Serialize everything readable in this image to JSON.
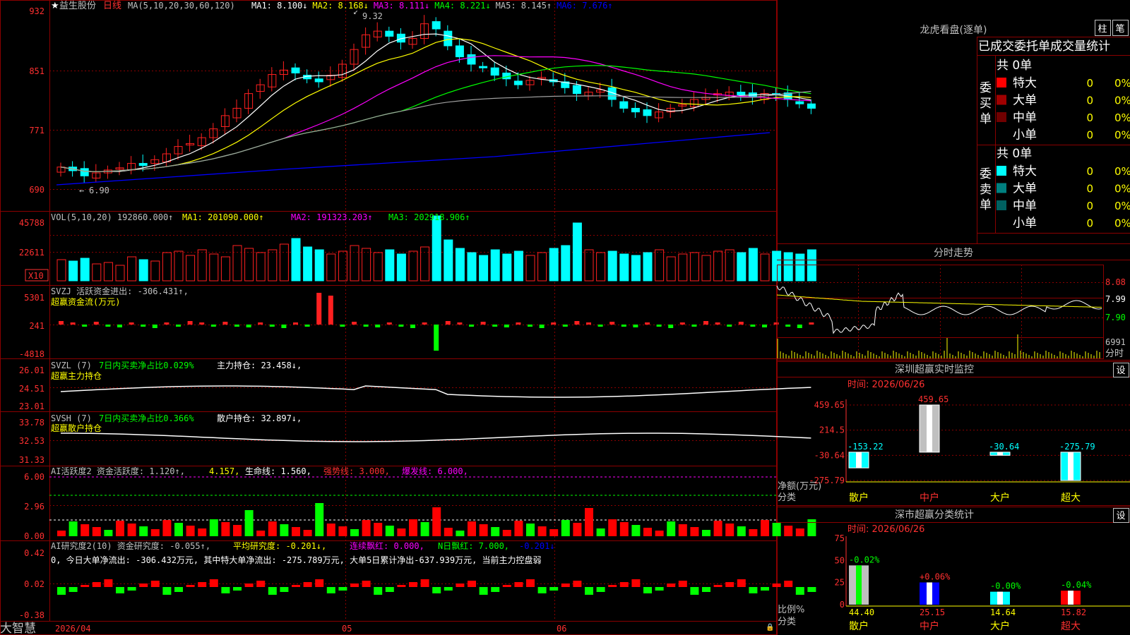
{
  "colors": {
    "up": "#ff2020",
    "down": "#00ffff",
    "grid": "#8b0000",
    "axis_text": "#ff4040"
  },
  "main": {
    "stock_name": "益生股份",
    "period": "日线",
    "ma_label": "MA(5,10,20,30,60,120)",
    "ma_values": [
      {
        "name": "MA1",
        "value": "8.100↓",
        "color": "#ffffff"
      },
      {
        "name": "MA2",
        "value": "8.168↓",
        "color": "#ffff00"
      },
      {
        "name": "MA3",
        "value": "8.111↓",
        "color": "#ff00ff"
      },
      {
        "name": "MA4",
        "value": "8.221↓",
        "color": "#00ff00"
      },
      {
        "name": "MA5",
        "value": "8.145↑",
        "color": "#c0c0c0"
      },
      {
        "name": "MA6",
        "value": "7.676↑",
        "color": "#0000ff"
      }
    ],
    "y_ticks": [
      "932",
      "851",
      "771",
      "690"
    ],
    "high_label": "9.32",
    "low_label": "6.90",
    "x_labels": [
      "2026/04",
      "05",
      "06"
    ],
    "corner_label": "大智慧"
  },
  "vol": {
    "header": "VOL(5,10,20)  192860.000↑",
    "ma1": "MA1: 201090.000↑",
    "ma2": "MA2: 191323.203↑",
    "ma3": "MA3: 202918.906↑",
    "y_ticks": [
      "45788",
      "22611"
    ],
    "unit": "X10"
  },
  "svzj": {
    "header": "SVZJ  活跃资金进出: -306.431↑,",
    "sub": "超赢资金流(万元)",
    "y_ticks": [
      "5301",
      "241",
      "-4818"
    ]
  },
  "svzl": {
    "header": "SVZL (7)",
    "green": "7日内买卖净占比0.029%",
    "white": "主力持仓: 23.458↓,",
    "sub": "超赢主力持仓",
    "y_ticks": [
      "26.01",
      "24.51",
      "23.01"
    ]
  },
  "svsh": {
    "header": "SVSH (7)",
    "green": "7日内买卖净占比0.366%",
    "white": "散户持仓: 32.897↓,",
    "sub": "超赢散户持仓",
    "y_ticks": [
      "33.78",
      "32.53",
      "31.33"
    ]
  },
  "ai1": {
    "header": "AI活跃度2 资金活跃度: 1.120↑,",
    "v2": "4.157,",
    "life": "生命线: 1.560,",
    "strong": "强势线: 3.000,",
    "burst": "爆发线: 6.000,",
    "y_ticks": [
      "6.00",
      "2.96",
      "0.00"
    ]
  },
  "ai2": {
    "header": "AI研究度2(10) 资金研究度: -0.055↑,",
    "avg": "平均研究度: -0.201↓,",
    "red": "连续飘红: 0.000,",
    "n": "N日飘红: 7.000,",
    "last": "-0.201↓",
    "desc": "0, 今日大单净流出: -306.432万元, 其中特大单净流出: -275.789万元, 大单5日累计净出-637.939万元, 当前主力控盘弱",
    "y_ticks": [
      "0.42",
      "0.02",
      "-0.38"
    ]
  },
  "right": {
    "dragon_title": "龙虎看盘(逐单)",
    "btn_bar": "柱",
    "btn_pen": "笔",
    "stats_title": "已成交委托单成交量统计",
    "buy": {
      "side": "委买单",
      "total": "共 0单",
      "rows": [
        {
          "label": "特大",
          "count": "0",
          "pct": "0%",
          "color": "#ff0000"
        },
        {
          "label": "大单",
          "count": "0",
          "pct": "0%",
          "color": "#a00000"
        },
        {
          "label": "中单",
          "count": "0",
          "pct": "0%",
          "color": "#700000"
        },
        {
          "label": "小单",
          "count": "0",
          "pct": "0%",
          "color": ""
        }
      ]
    },
    "sell": {
      "side": "委卖单",
      "total": "共 0单",
      "rows": [
        {
          "label": "特大",
          "count": "0",
          "pct": "0%",
          "color": "#00ffff"
        },
        {
          "label": "大单",
          "count": "0",
          "pct": "0%",
          "color": "#008080"
        },
        {
          "label": "中单",
          "count": "0",
          "pct": "0%",
          "color": "#006060"
        },
        {
          "label": "小单",
          "count": "0",
          "pct": "0%",
          "color": ""
        }
      ]
    },
    "intraday_title": "分时走势",
    "intraday_y": [
      "8.08",
      "7.99",
      "7.90"
    ],
    "intraday_vol": "6991",
    "intraday_vol_label": "分时",
    "monitor_title": "深圳超赢实时监控",
    "monitor_time": "时间: 2026/06/26",
    "monitor_btn": "设",
    "monitor_y": [
      "459.65",
      "214.5",
      "-30.64",
      "-275.79"
    ],
    "monitor_axis_label": "净额(万元)",
    "monitor_axis_label2": "分类",
    "class_title": "深市超赢分类统计",
    "class_time": "时间: 2026/06/26",
    "class_btn": "设",
    "class_y": [
      "75",
      "50",
      "25",
      "0"
    ],
    "class_axis_label": "比例%",
    "class_axis_label2": "分类"
  },
  "chart_data": [
    {
      "type": "bar",
      "title": "深圳超赢实时监控",
      "categories": [
        "散户",
        "中户",
        "大户",
        "超大"
      ],
      "values": [
        -153.22,
        459.65,
        -30.64,
        -275.79
      ],
      "ylabel": "净额(万元)",
      "xlabel": "分类",
      "ylim": [
        -275.79,
        459.65
      ]
    },
    {
      "type": "bar",
      "title": "深市超赢分类统计",
      "categories": [
        "散户",
        "中户",
        "大户",
        "超大"
      ],
      "values": [
        44.4,
        25.15,
        14.64,
        15.82
      ],
      "changes": [
        "-0.02%",
        "+0.06%",
        "-0.00%",
        "-0.04%"
      ],
      "ylabel": "比例%",
      "xlabel": "分类",
      "ylim": [
        0,
        75
      ]
    }
  ]
}
